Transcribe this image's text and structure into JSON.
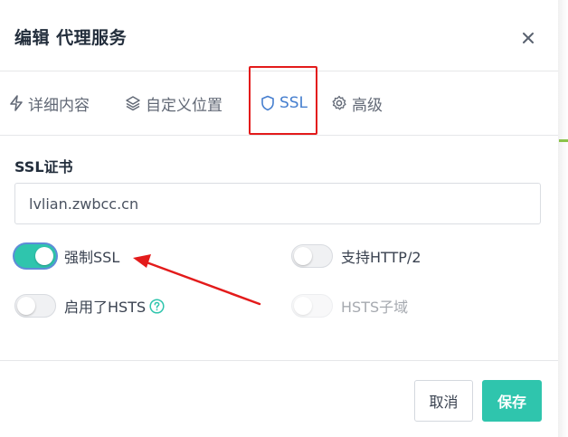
{
  "modal": {
    "title": "编辑 代理服务"
  },
  "tabs": [
    {
      "label": "详细内容",
      "icon": "lightning-icon"
    },
    {
      "label": "自定义位置",
      "icon": "layers-icon"
    },
    {
      "label": "SSL",
      "icon": "shield-icon",
      "active": true
    },
    {
      "label": "高级",
      "icon": "gear-icon"
    }
  ],
  "ssl": {
    "certificate_label": "SSL证书",
    "certificate_value": "lvlian.zwbcc.cn",
    "toggles": {
      "force_ssl": {
        "label": "强制SSL",
        "on": true
      },
      "http2": {
        "label": "支持HTTP/2",
        "on": false
      },
      "hsts": {
        "label": "启用了HSTS",
        "on": false
      },
      "hsts_subdomains": {
        "label": "HSTS子域",
        "on": false,
        "disabled": true
      }
    }
  },
  "footer": {
    "cancel_label": "取消",
    "save_label": "保存"
  },
  "colors": {
    "accent": "#467fcf",
    "teal": "#2fc5ad",
    "annotation_red": "#e31b1b"
  }
}
